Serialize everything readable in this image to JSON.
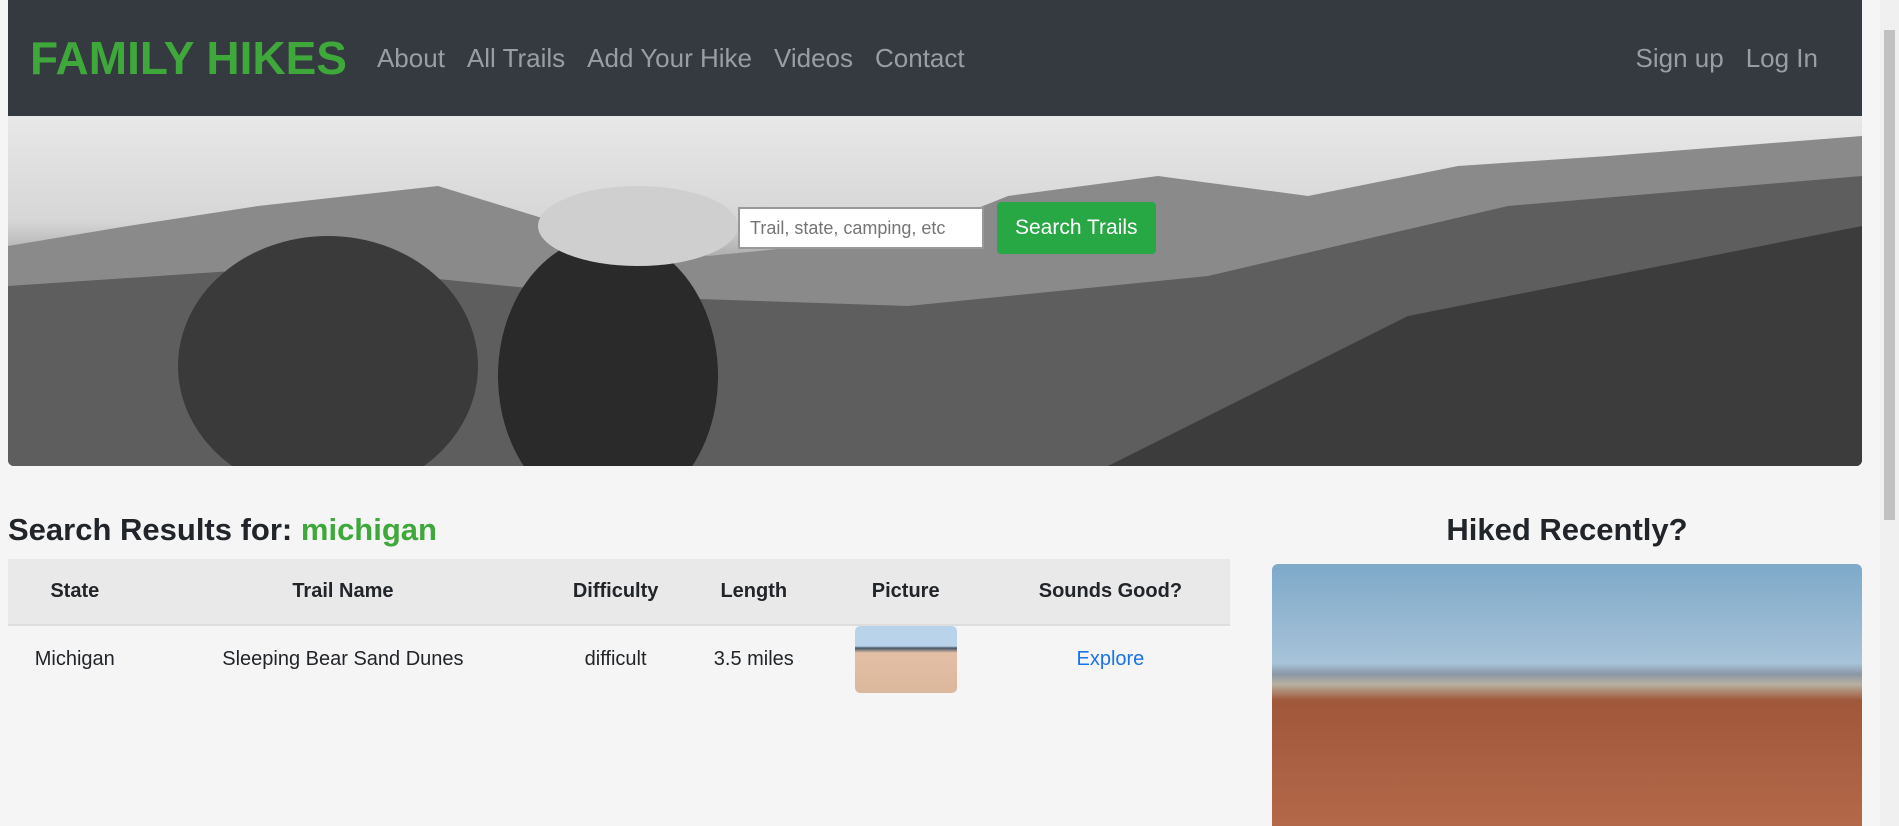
{
  "nav": {
    "brand": "FAMILY HIKES",
    "links": [
      "About",
      "All Trails",
      "Add Your Hike",
      "Videos",
      "Contact"
    ],
    "sign_up": "Sign up",
    "log_in": "Log In"
  },
  "hero": {
    "search_placeholder": "Trail, state, camping, etc",
    "search_button": "Search Trails"
  },
  "results": {
    "prefix": "Search Results for:",
    "query": "michigan",
    "headers": [
      "State",
      "Trail Name",
      "Difficulty",
      "Length",
      "Picture",
      "Sounds Good?"
    ],
    "rows": [
      {
        "state": "Michigan",
        "trail": "Sleeping Bear Sand Dunes",
        "difficulty": "difficult",
        "length": "3.5 miles",
        "link": "Explore"
      }
    ]
  },
  "sidebar": {
    "title": "Hiked Recently?"
  },
  "colors": {
    "brand": "#3fa83a",
    "button": "#28a745",
    "link": "#1a73e8",
    "nav_bg": "#343a40"
  }
}
